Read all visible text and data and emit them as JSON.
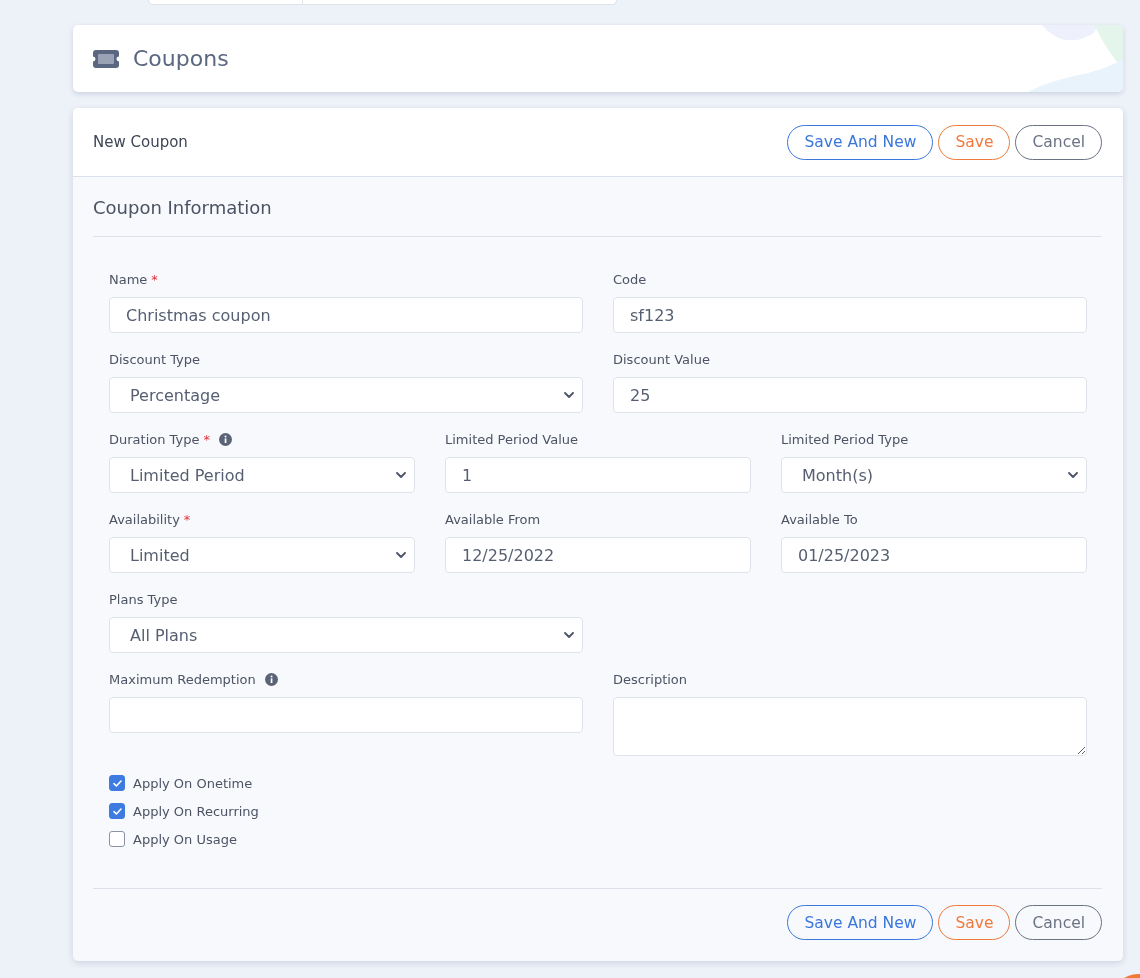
{
  "page": {
    "title": "Coupons"
  },
  "form": {
    "title": "New Coupon",
    "header_actions": [
      {
        "label": "Save And New"
      },
      {
        "label": "Save"
      },
      {
        "label": "Cancel"
      }
    ],
    "section_title": "Coupon Information",
    "rows": [
      [
        {
          "label": "Name",
          "required_mark": "*",
          "kind": "text",
          "value": "Christmas coupon"
        },
        {
          "label": "Code",
          "kind": "text",
          "value": "sf123"
        }
      ],
      [
        {
          "label": "Discount Type",
          "kind": "select",
          "value": "Percentage"
        },
        {
          "label": "Discount Value",
          "kind": "text",
          "value": "25"
        }
      ],
      [
        {
          "label": "Duration Type",
          "required_mark": "*",
          "info_icon": true,
          "kind": "select",
          "value": "Limited Period"
        },
        {
          "label": "Limited Period Value",
          "kind": "text",
          "value": "1"
        },
        {
          "label": "Limited Period Type",
          "kind": "select",
          "value": "Month(s)"
        }
      ],
      [
        {
          "label": "Availability",
          "required_mark": "*",
          "kind": "select",
          "value": "Limited"
        },
        {
          "label": "Available From",
          "kind": "text",
          "value": "12/25/2022"
        },
        {
          "label": "Available To",
          "kind": "text",
          "value": "01/25/2023"
        }
      ],
      [
        {
          "label": "Plans Type",
          "kind": "select",
          "value": "All Plans"
        }
      ],
      [
        {
          "label": "Maximum Redemption",
          "info_icon": true,
          "kind": "text"
        },
        {
          "label": "Description",
          "kind": "textarea"
        }
      ]
    ],
    "checkboxes": [
      {
        "label": "Apply On Onetime",
        "checked": true
      },
      {
        "label": "Apply On Recurring",
        "checked": true
      },
      {
        "label": "Apply On Usage",
        "checked": false
      }
    ],
    "footer_actions": [
      {
        "label": "Save And New"
      },
      {
        "label": "Save"
      },
      {
        "label": "Cancel"
      }
    ]
  }
}
